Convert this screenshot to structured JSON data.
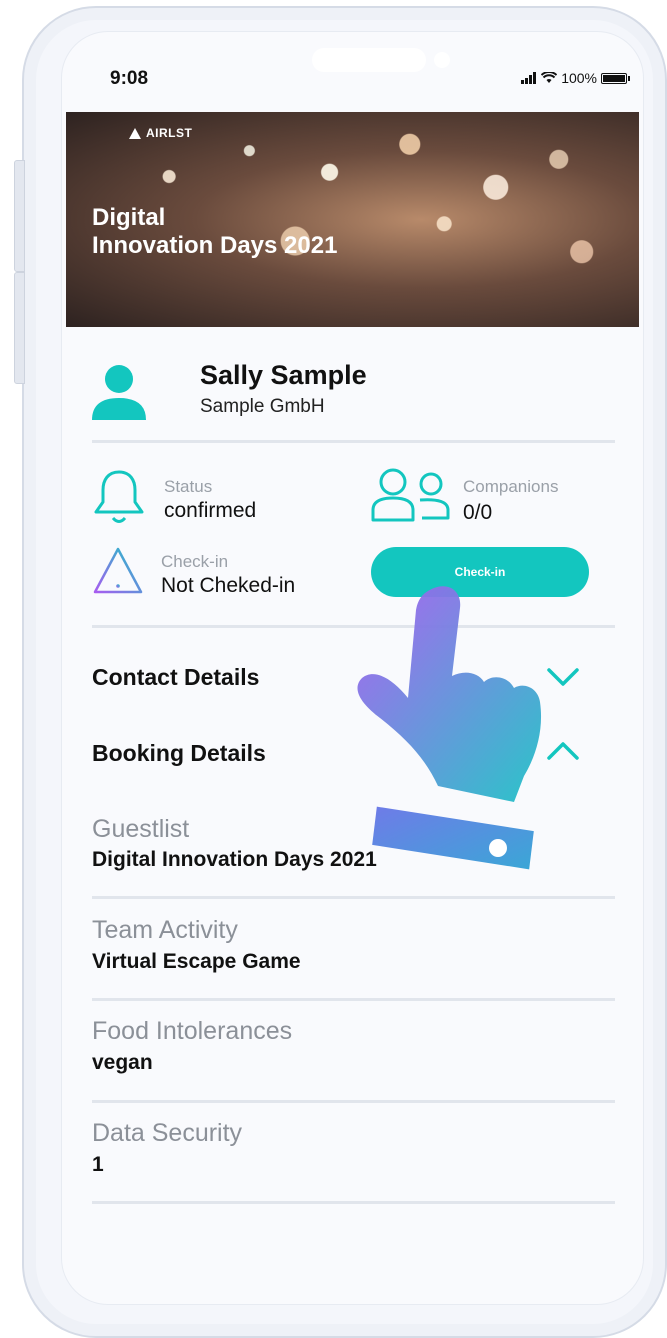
{
  "status_bar": {
    "time": "9:08",
    "battery": "100%"
  },
  "banner": {
    "logo": "AIRLST",
    "title_line1": "Digital",
    "title_line2": "Innovation Days 2021"
  },
  "profile": {
    "name": "Sally Sample",
    "company": "Sample GmbH"
  },
  "status": {
    "label": "Status",
    "value": "confirmed"
  },
  "companions": {
    "label": "Companions",
    "value": "0/0"
  },
  "checkin": {
    "label": "Check-in",
    "value": "Not Cheked-in",
    "button": "Check-in"
  },
  "sections": {
    "contact": "Contact Details",
    "booking": "Booking Details"
  },
  "booking_fields": [
    {
      "label": "Guestlist",
      "value": "Digital Innovation Days 2021"
    },
    {
      "label": "Team Activity",
      "value": "Virtual Escape Game"
    },
    {
      "label": "Food Intolerances",
      "value": "vegan"
    },
    {
      "label": "Data Security",
      "value": "1"
    }
  ],
  "colors": {
    "accent": "#13c6bf",
    "gradient_start": "#a85cf0",
    "gradient_end": "#1fc2c6"
  },
  "icons": [
    "person-icon",
    "bell-icon",
    "companions-icon",
    "warning-icon",
    "chevron-down-icon",
    "chevron-up-icon",
    "pointing-hand-icon",
    "wifi-icon",
    "signal-icon",
    "battery-icon"
  ]
}
